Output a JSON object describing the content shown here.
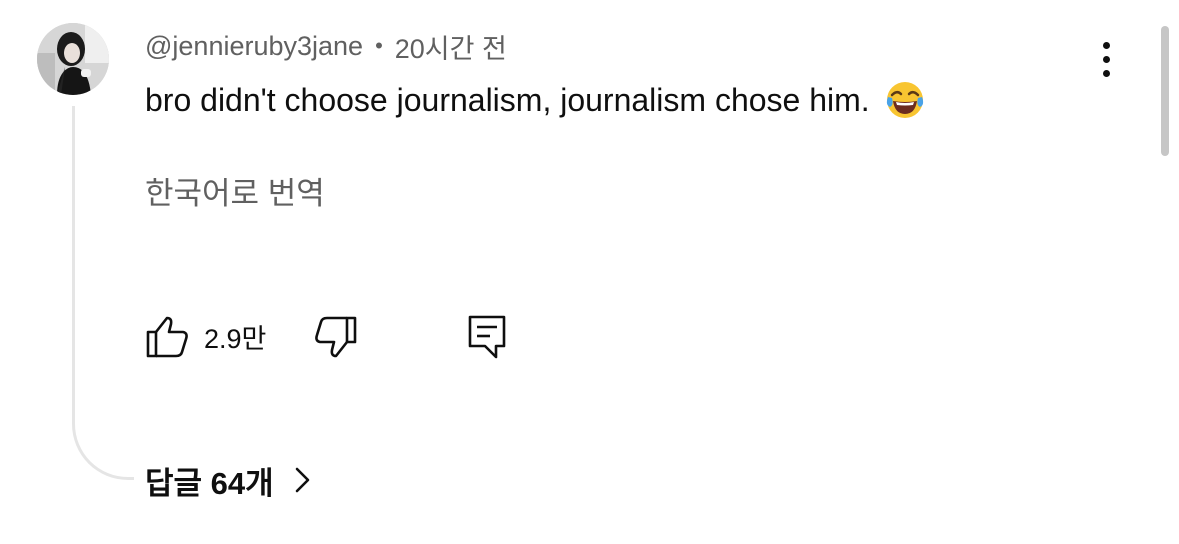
{
  "comment": {
    "author": "@jennieruby3jane",
    "separator": "•",
    "time": "20시간 전",
    "text": "bro didn't choose journalism, journalism chose him.",
    "emoji": "face-with-tears-of-joy-icon",
    "translate_label": "한국어로 번역"
  },
  "actions": {
    "like_icon": "thumbs-up-icon",
    "like_count": "2.9만",
    "dislike_icon": "thumbs-down-icon",
    "reply_icon": "comment-reply-icon",
    "more_icon": "more-vertical-icon"
  },
  "replies": {
    "label": "답글 64개",
    "icon": "chevron-right-icon"
  },
  "colors": {
    "text_primary": "#0f0f0f",
    "text_secondary": "#606060",
    "thread_line": "#e5e5e5",
    "scrollbar": "#c6c6c6"
  }
}
